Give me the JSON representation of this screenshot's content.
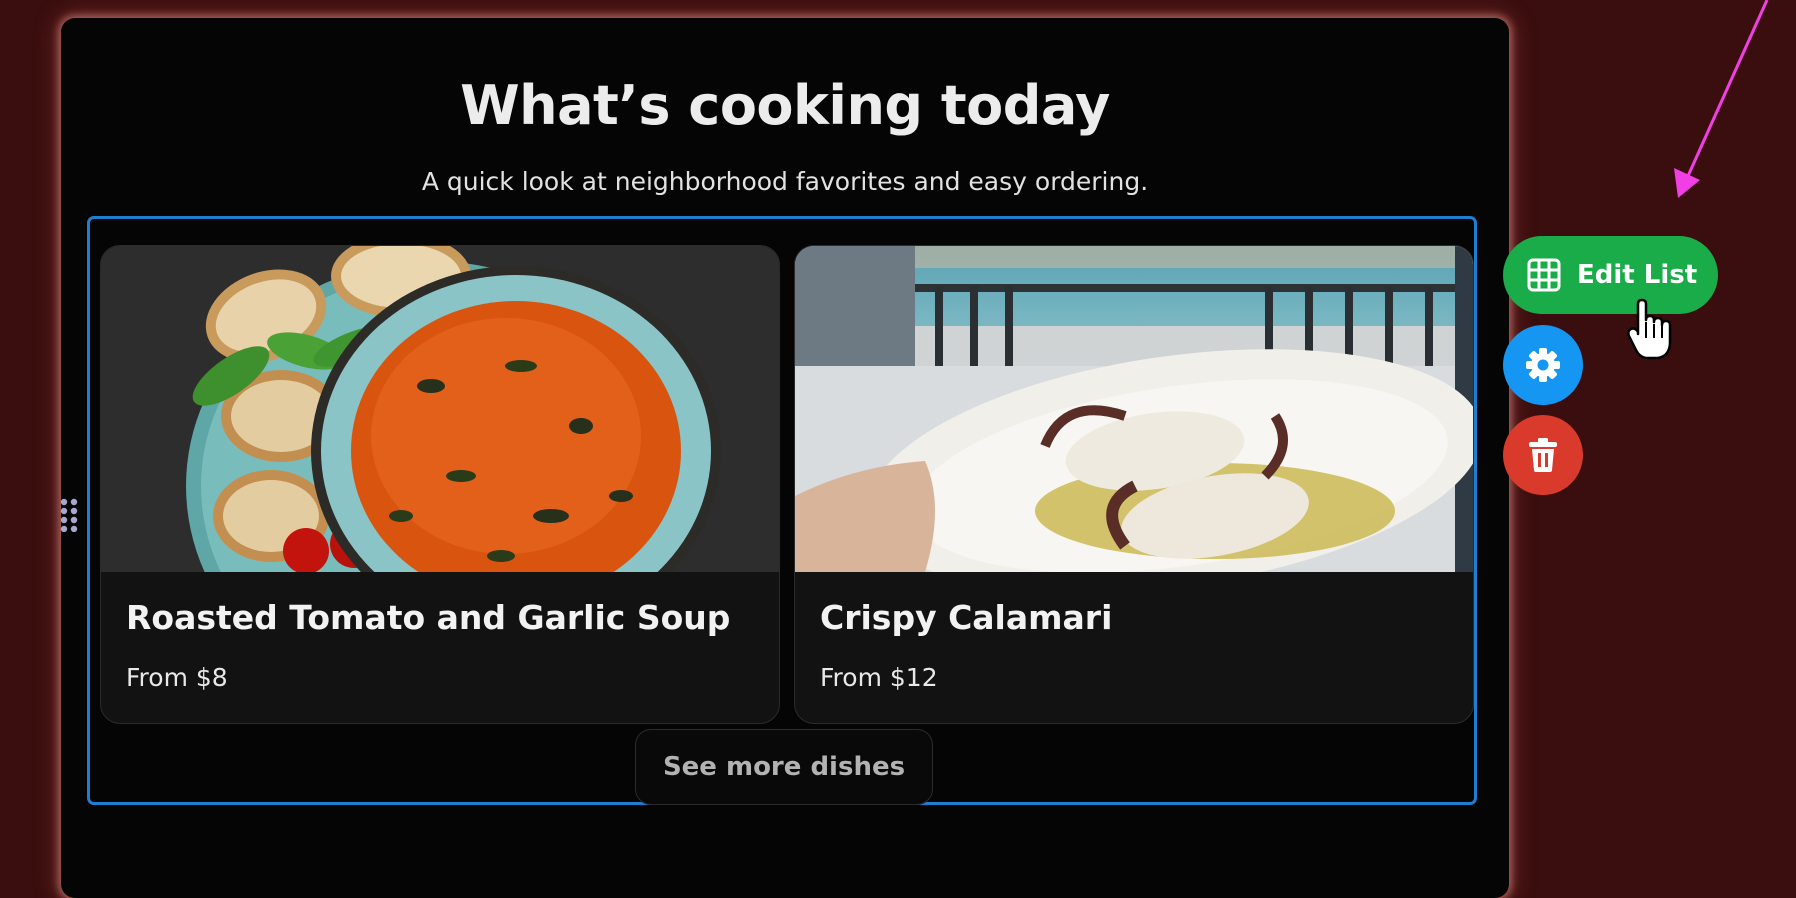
{
  "section": {
    "title": "What’s cooking today",
    "subtitle": "A quick look at neighborhood favorites and easy ordering."
  },
  "dishes": [
    {
      "name": "Roasted Tomato and Garlic Soup",
      "price": "From $8",
      "image": "tomato-soup-photo"
    },
    {
      "name": "Crispy Calamari",
      "price": "From $12",
      "image": "grilled-calamari-photo"
    }
  ],
  "see_more_label": "See more dishes",
  "toolbar": {
    "edit_list_label": "Edit List",
    "edit_list_icon": "table-icon",
    "settings_icon": "gear-icon",
    "delete_icon": "trash-icon"
  },
  "colors": {
    "background": "#3a0e0e",
    "panel": "#050505",
    "selection_border": "#1d7fd1",
    "edit_button": "#1bac4a",
    "settings_button": "#1596f3",
    "delete_button": "#d93a2b",
    "annotation_arrow": "#f23fe5"
  }
}
